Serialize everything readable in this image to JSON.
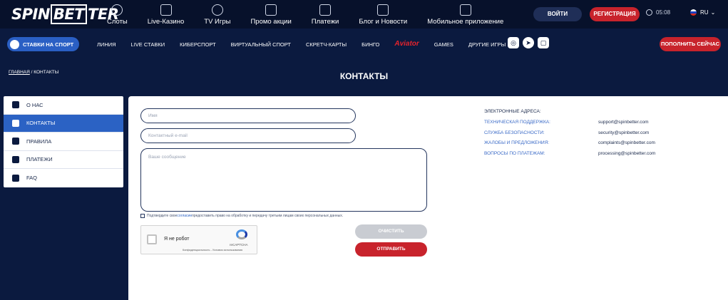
{
  "header": {
    "logo_left": "SPIN",
    "logo_mid": "BET",
    "logo_right": "TER",
    "nav": [
      {
        "label": "Слоты",
        "icon": "bike-icon"
      },
      {
        "label": "Live-Казино",
        "icon": "phone-cards-icon"
      },
      {
        "label": "TV Игры",
        "icon": "gamepad-icon"
      },
      {
        "label": "Промо акции",
        "icon": "gift-icon"
      },
      {
        "label": "Платежи",
        "icon": "wallet-icon"
      },
      {
        "label": "Блог и Новости",
        "icon": "news-icon"
      },
      {
        "label": "Мобильное приложение",
        "icon": "mobile-icon"
      }
    ],
    "login_label": "ВОЙТИ",
    "register_label": "РЕГИСТРАЦИЯ",
    "time": "05:08",
    "language": "RU"
  },
  "subnav": {
    "sports_label": "СТАВКИ НА СПОРТ",
    "items": [
      "ЛИНИЯ",
      "LIVE СТАВКИ",
      "КИБЕРСПОРТ",
      "ВИРТУАЛЬНЫЙ СПОРТ",
      "СКРЕТЧ-КАРТЫ",
      "БИНГО",
      "Aviator",
      "GAMES",
      "ДРУГИЕ ИГРЫ"
    ],
    "deposit_label": "ПОПОЛНИТЬ СЕЙЧАС"
  },
  "breadcrumb": {
    "home": "ГЛАВНАЯ",
    "separator": "/",
    "current": "КОНТАКТЫ"
  },
  "page_title": "КОНТАКТЫ",
  "sidebar": {
    "items": [
      {
        "label": "О НАС",
        "icon": "info-icon",
        "active": false
      },
      {
        "label": "КОНТАКТЫ",
        "icon": "phone-icon",
        "active": true
      },
      {
        "label": "ПРАВИЛА",
        "icon": "document-icon",
        "active": false
      },
      {
        "label": "ПЛАТЕЖИ",
        "icon": "card-icon",
        "active": false
      },
      {
        "label": "FAQ",
        "icon": "chat-icon",
        "active": false
      }
    ]
  },
  "form": {
    "name_placeholder": "Имя",
    "email_placeholder": "Контактный e-mail",
    "message_placeholder": "Ваше сообщение",
    "consent_text_pre": "Подтвердите свое ",
    "consent_link": "согласие",
    "consent_text_post": " предоставить право на обработку и передачу третьим лицам своих персональных данных.",
    "captcha_label": "Я не робот",
    "captcha_brand": "reCAPTCHA",
    "captcha_terms": "Конфиденциальность - Условия использования",
    "clear_label": "ОЧИСТИТЬ",
    "send_label": "ОТПРАВИТЬ"
  },
  "contacts": {
    "header": "ЭЛЕКТРОННЫЕ АДРЕСА:",
    "rows": [
      {
        "key": "ТЕХНИЧЕСКАЯ ПОДДЕРЖКА:",
        "value": "support@spinbetter.com"
      },
      {
        "key": "СЛУЖБА БЕЗОПАСНОСТИ:",
        "value": "security@spinbetter.com"
      },
      {
        "key": "ЖАЛОБЫ И ПРЕДЛОЖЕНИЯ:",
        "value": "complaints@spinbetter.com"
      },
      {
        "key": "ВОПРОСЫ ПО ПЛАТЕЖАМ:",
        "value": "processing@spinbetter.com"
      }
    ]
  },
  "colors": {
    "background": "#0b1a3f",
    "accent_red": "#c8232c",
    "accent_blue": "#2b62c4"
  }
}
